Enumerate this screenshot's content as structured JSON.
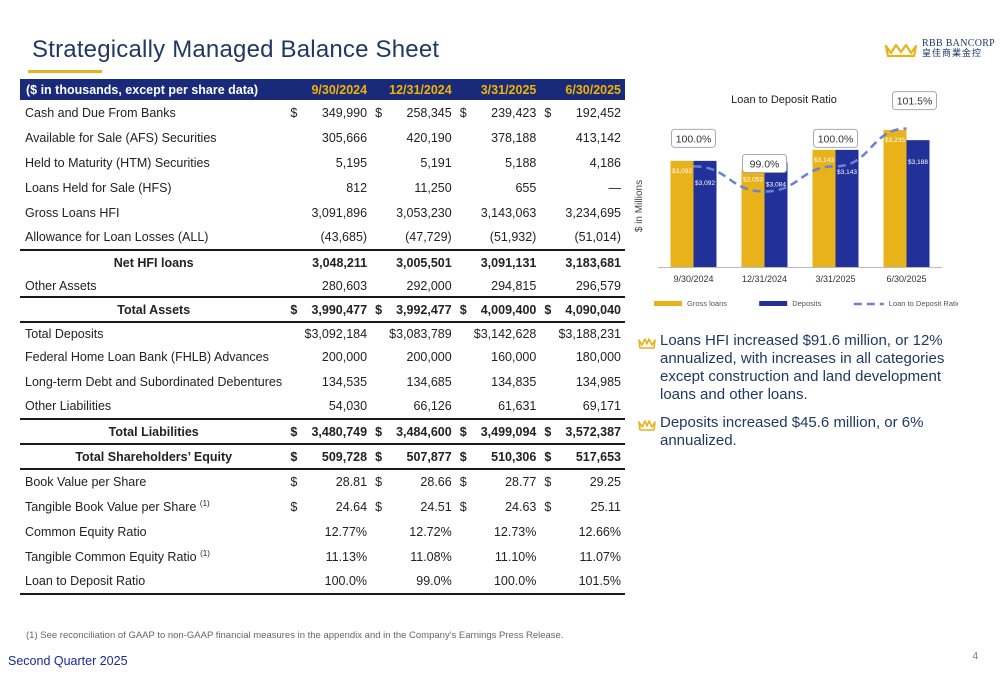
{
  "slide": {
    "title": "Strategically Managed Balance Sheet",
    "footer_label": "Second Quarter 2025",
    "page_number": "4",
    "footnote": "(1) See reconciliation of GAAP to non-GAAP financial measures in the appendix and in the Company's Earnings Press Release.",
    "logo_name": "RBB BANCORP",
    "logo_sub": "皇佳商業金控"
  },
  "colors": {
    "navy": "#1a2a7a",
    "gold": "#e8b21a",
    "dark_blue": "#1f3864"
  },
  "table": {
    "header": [
      "($ in thousands, except per share data)",
      "9/30/2024",
      "12/31/2024",
      "3/31/2025",
      "6/30/2025"
    ],
    "rows": [
      {
        "label": "Cash and Due From Banks",
        "v": [
          "$",
          "349,990",
          "$",
          "258,345",
          "$",
          "239,423",
          "$",
          "192,452"
        ]
      },
      {
        "label": "Available for Sale (AFS) Securities",
        "v": [
          "",
          "305,666",
          "",
          "420,190",
          "",
          "378,188",
          "",
          "413,142"
        ]
      },
      {
        "label": "Held to Maturity (HTM) Securities",
        "v": [
          "",
          "5,195",
          "",
          "5,191",
          "",
          "5,188",
          "",
          "4,186"
        ]
      },
      {
        "label": "Loans Held for Sale (HFS)",
        "v": [
          "",
          "812",
          "",
          "11,250",
          "",
          "655",
          "",
          "—"
        ]
      },
      {
        "label": "Gross Loans HFI",
        "v": [
          "",
          "3,091,896",
          "",
          "3,053,230",
          "",
          "3,143,063",
          "",
          "3,234,695"
        ]
      },
      {
        "label": "Allowance for Loan Losses (ALL)",
        "v": [
          "",
          "(43,685)",
          "",
          "(47,729)",
          "",
          "(51,932)",
          "",
          "(51,014)"
        ]
      },
      {
        "label": "Net HFI loans",
        "v": [
          "",
          "3,048,211",
          "",
          "3,005,501",
          "",
          "3,091,131",
          "",
          "3,183,681"
        ]
      },
      {
        "label": "Other Assets",
        "v": [
          "",
          "280,603",
          "",
          "292,000",
          "",
          "294,815",
          "",
          "296,579"
        ]
      },
      {
        "label": "Total Assets",
        "v": [
          "$",
          "3,990,477",
          "$",
          "3,992,477",
          "$",
          "4,009,400",
          "$",
          "4,090,040"
        ]
      },
      {
        "label": "Total Deposits",
        "v": [
          "",
          "$3,092,184",
          "",
          "$3,083,789",
          "",
          "$3,142,628",
          "",
          "$3,188,231"
        ]
      },
      {
        "label": "Federal Home Loan Bank (FHLB) Advances",
        "v": [
          "",
          "200,000",
          "",
          "200,000",
          "",
          "160,000",
          "",
          "180,000"
        ]
      },
      {
        "label": "Long-term Debt and Subordinated Debentures",
        "v": [
          "",
          "134,535",
          "",
          "134,685",
          "",
          "134,835",
          "",
          "134,985"
        ]
      },
      {
        "label": "Other Liabilities",
        "v": [
          "",
          "54,030",
          "",
          "66,126",
          "",
          "61,631",
          "",
          "69,171"
        ]
      },
      {
        "label": "Total Liabilities",
        "v": [
          "$",
          "3,480,749",
          "$",
          "3,484,600",
          "$",
          "3,499,094",
          "$",
          "3,572,387"
        ]
      },
      {
        "label": "Total Shareholders’ Equity",
        "v": [
          "$",
          "509,728",
          "$",
          "507,877",
          "$",
          "510,306",
          "$",
          "517,653"
        ]
      },
      {
        "label": "Book Value per Share",
        "v": [
          "$",
          "28.81",
          "$",
          "28.66",
          "$",
          "28.77",
          "$",
          "29.25"
        ]
      },
      {
        "label": "Tangible Book Value per Share",
        "sup": "(1)",
        "v": [
          "$",
          "24.64",
          "$",
          "24.51",
          "$",
          "24.63",
          "$",
          "25.11"
        ]
      },
      {
        "label": "Common Equity Ratio",
        "v": [
          "",
          "12.77%",
          "",
          "12.72%",
          "",
          "12.73%",
          "",
          "12.66%"
        ]
      },
      {
        "label": "Tangible Common Equity Ratio",
        "sup": "(1)",
        "v": [
          "",
          "11.13%",
          "",
          "11.08%",
          "",
          "11.10%",
          "",
          "11.07%"
        ]
      },
      {
        "label": "Loan to Deposit Ratio",
        "v": [
          "",
          "100.0%",
          "",
          "99.0%",
          "",
          "100.0%",
          "",
          "101.5%"
        ]
      }
    ]
  },
  "bullets": [
    "Loans HFI increased $91.6 million, or 12% annualized, with increases in all categories except construction and land development loans and other loans.",
    "Deposits increased $45.6 million, or 6% annualized."
  ],
  "chart_data": {
    "type": "bar",
    "title": "Loan to Deposit Ratio",
    "ylabel": "$ in Millions",
    "categories": [
      "9/30/2024",
      "12/31/2024",
      "3/31/2025",
      "6/30/2025"
    ],
    "series": [
      {
        "name": "Gross loans",
        "color": "#e8b21a",
        "values": [
          3092,
          3053,
          3143,
          3235
        ],
        "labels": [
          "$3,092",
          "$3,053",
          "$3,143",
          "$3,235"
        ]
      },
      {
        "name": "Deposits",
        "color": "#22319a",
        "values": [
          3092,
          3084,
          3143,
          3188
        ],
        "labels": [
          "$3,092",
          "$3,084",
          "$3,143",
          "$3,188"
        ]
      }
    ],
    "line_series": {
      "name": "Loan to Deposit Ratio",
      "color": "#6a82d4",
      "values": [
        100.0,
        99.0,
        100.0,
        101.5
      ],
      "labels": [
        "100.0%",
        "99.0%",
        "100.0%",
        "101.5%"
      ]
    },
    "ylim": [
      2600,
      3300
    ],
    "line_ylim": [
      96,
      102
    ],
    "legend": "bottom",
    "grid": false
  }
}
